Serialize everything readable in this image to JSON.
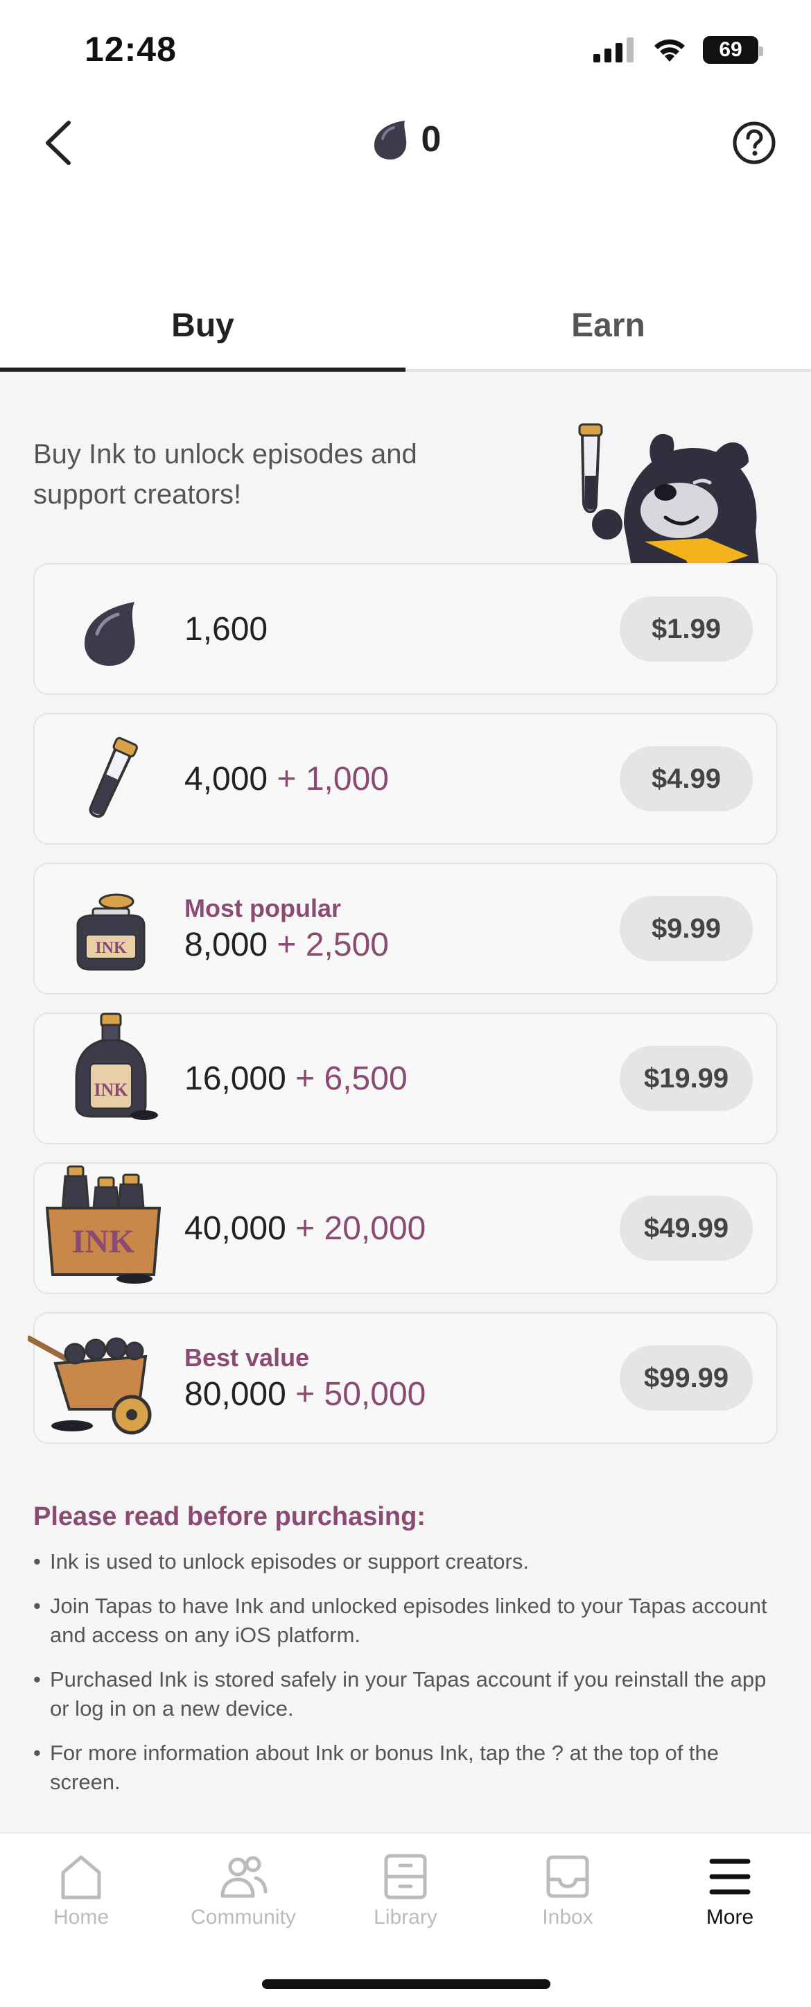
{
  "status_bar": {
    "time": "12:48",
    "battery": "69"
  },
  "header": {
    "ink_balance": "0"
  },
  "tabs": [
    {
      "label": "Buy",
      "active": true
    },
    {
      "label": "Earn",
      "active": false
    }
  ],
  "intro_text": "Buy Ink to unlock episodes and support creators!",
  "packages": [
    {
      "tag": "",
      "amount": "1,600",
      "bonus": "",
      "price": "$1.99",
      "icon": "ink-drop-icon"
    },
    {
      "tag": "",
      "amount": "4,000",
      "bonus": "+ 1,000",
      "price": "$4.99",
      "icon": "ink-vial-icon"
    },
    {
      "tag": "Most popular",
      "amount": "8,000",
      "bonus": "+ 2,500",
      "price": "$9.99",
      "icon": "ink-jar-icon"
    },
    {
      "tag": "",
      "amount": "16,000",
      "bonus": "+ 6,500",
      "price": "$19.99",
      "icon": "ink-bottle-icon"
    },
    {
      "tag": "",
      "amount": "40,000",
      "bonus": "+ 20,000",
      "price": "$49.99",
      "icon": "ink-crate-icon"
    },
    {
      "tag": "Best value",
      "amount": "80,000",
      "bonus": "+ 50,000",
      "price": "$99.99",
      "icon": "ink-wheelbarrow-icon"
    }
  ],
  "notes": {
    "title": "Please read before purchasing:",
    "items": [
      "Ink is used to unlock episodes or support creators.",
      "Join Tapas to have Ink and unlocked episodes linked to your Tapas account and access on any iOS platform.",
      "Purchased Ink is stored safely in your Tapas account if you reinstall the app or log in on a new device.",
      "For more information about Ink or bonus Ink, tap the ? at the top of the screen."
    ]
  },
  "nav": [
    {
      "label": "Home",
      "icon": "home-icon",
      "active": false
    },
    {
      "label": "Community",
      "icon": "community-icon",
      "active": false
    },
    {
      "label": "Library",
      "icon": "library-icon",
      "active": false
    },
    {
      "label": "Inbox",
      "icon": "inbox-icon",
      "active": false
    },
    {
      "label": "More",
      "icon": "menu-icon",
      "active": true
    }
  ],
  "colors": {
    "accent": "#8a4a72",
    "ink": "#3b3b4a",
    "muted": "#bbbbbb"
  }
}
